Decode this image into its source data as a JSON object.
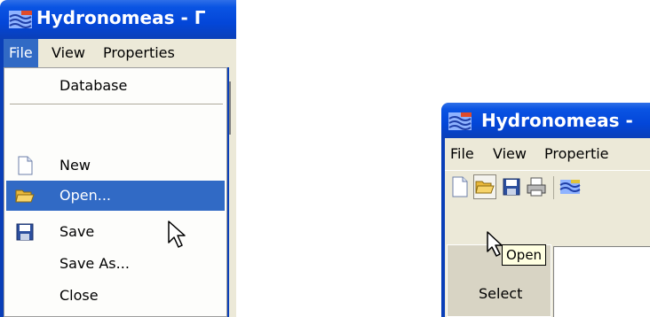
{
  "left_window": {
    "title": "Hydronomeas - Γ",
    "menubar": [
      "File",
      "View",
      "Properties"
    ],
    "file_menu": {
      "items": [
        {
          "label": "Database",
          "icon": "none"
        },
        {
          "label": "New",
          "icon": "new-file-icon"
        },
        {
          "label": "Open...",
          "icon": "open-folder-icon",
          "highlighted": true
        },
        {
          "label": "Save",
          "icon": "floppy-save-icon"
        },
        {
          "label": "Save As...",
          "icon": "none"
        },
        {
          "label": "Close",
          "icon": "none"
        }
      ]
    }
  },
  "right_window": {
    "title": "Hydronomeas -",
    "menubar": [
      "File",
      "View",
      "Propertie"
    ],
    "toolbar": [
      "new-file-icon",
      "open-folder-icon",
      "floppy-save-icon",
      "printer-icon",
      "hydronomeas-icon"
    ],
    "tooltip": "Open",
    "select_label": "Select"
  },
  "colors": {
    "titlebar": "#0a54e3",
    "menu_highlight": "#316ac5",
    "window_face": "#ece9d8",
    "tooltip_bg": "#ffffe1"
  }
}
